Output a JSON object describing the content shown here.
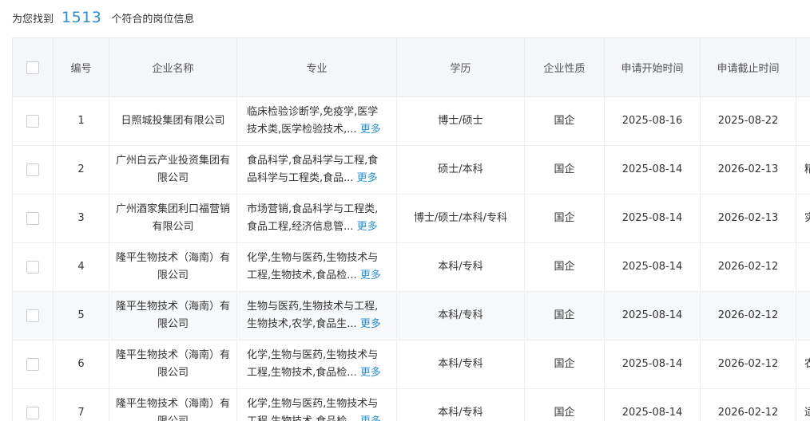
{
  "summary": {
    "prefix": "为您找到",
    "count": "1513",
    "suffix": "个符合的岗位信息"
  },
  "headers": {
    "number": "编号",
    "enterprise": "企业名称",
    "major": "专业",
    "education": "学历",
    "nature": "企业性质",
    "start": "申请开始时间",
    "end": "申请截止时间"
  },
  "more_label": "更多",
  "rows": [
    {
      "number": "1",
      "enterprise": "日照城投集团有限公司",
      "major_line1": "临床检验诊断学,免疫学,医学",
      "major_line2": "技术类,医学检验技术,...",
      "education": "博士/硕士",
      "nature": "国企",
      "start": "2025-08-16",
      "end": "2025-08-22",
      "extra": ""
    },
    {
      "number": "2",
      "enterprise": "广州白云产业投资集团有限公司",
      "major_line1": "食品科学,食品科学与工程,食",
      "major_line2": "品科学与工程类,食品...",
      "education": "硕士/本科",
      "nature": "国企",
      "start": "2025-08-14",
      "end": "2026-02-13",
      "extra": "精"
    },
    {
      "number": "3",
      "enterprise": "广州酒家集团利口福营销有限公司",
      "major_line1": "市场营销,食品科学与工程类,",
      "major_line2": "食品工程,经济信息管...",
      "education": "博士/硕士/本科/专科",
      "nature": "国企",
      "start": "2025-08-14",
      "end": "2026-02-13",
      "extra": "实"
    },
    {
      "number": "4",
      "enterprise": "隆平生物技术（海南）有限公司",
      "major_line1": "化学,生物与医药,生物技术与",
      "major_line2": "工程,生物技术,食品检...",
      "education": "本科/专科",
      "nature": "国企",
      "start": "2025-08-14",
      "end": "2026-02-12",
      "extra": ""
    },
    {
      "number": "5",
      "enterprise": "隆平生物技术（海南）有限公司",
      "major_line1": "生物与医药,生物技术与工程,",
      "major_line2": "生物技术,农学,食品生...",
      "education": "本科/专科",
      "nature": "国企",
      "start": "2025-08-14",
      "end": "2026-02-12",
      "extra": ""
    },
    {
      "number": "6",
      "enterprise": "隆平生物技术（海南）有限公司",
      "major_line1": "化学,生物与医药,生物技术与",
      "major_line2": "工程,生物技术,食品检...",
      "education": "本科/专科",
      "nature": "国企",
      "start": "2025-08-14",
      "end": "2026-02-12",
      "extra": "农"
    },
    {
      "number": "7",
      "enterprise": "隆平生物技术（海南）有限公司",
      "major_line1": "化学,生物与医药,生物技术与",
      "major_line2": "工程,生物技术,食品检...",
      "education": "本科/专科",
      "nature": "国企",
      "start": "2025-08-14",
      "end": "2026-02-12",
      "extra": "适"
    }
  ]
}
